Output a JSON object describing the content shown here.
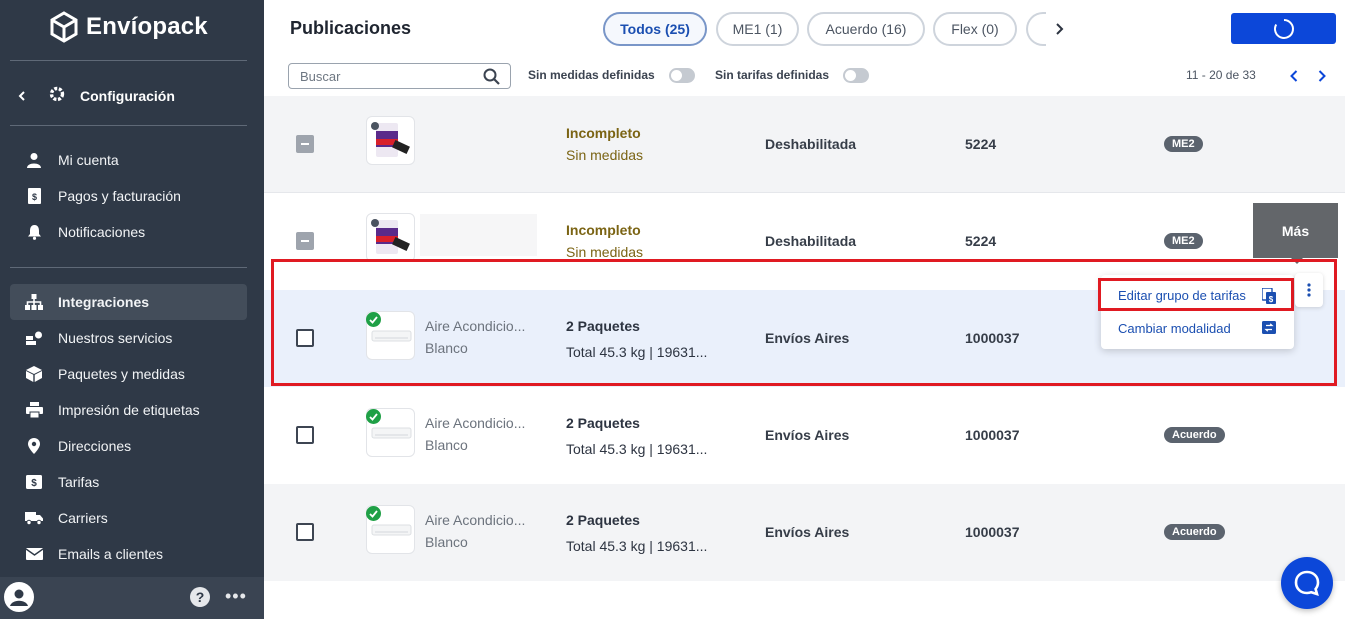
{
  "app": {
    "brand": "Envíopack"
  },
  "sidebar": {
    "config_label": "Configuración",
    "account_items": [
      {
        "label": "Mi cuenta",
        "icon": "user-icon"
      },
      {
        "label": "Pagos y facturación",
        "icon": "invoice-icon"
      },
      {
        "label": "Notificaciones",
        "icon": "bell-icon"
      }
    ],
    "main_items": [
      {
        "label": "Integraciones",
        "icon": "sitemap-icon",
        "active": true
      },
      {
        "label": "Nuestros servicios",
        "icon": "services-icon"
      },
      {
        "label": "Paquetes y medidas",
        "icon": "box-icon"
      },
      {
        "label": "Impresión de etiquetas",
        "icon": "printer-icon"
      },
      {
        "label": "Direcciones",
        "icon": "map-pin-icon"
      },
      {
        "label": "Tarifas",
        "icon": "money-icon"
      },
      {
        "label": "Carriers",
        "icon": "truck-icon"
      },
      {
        "label": "Emails a clientes",
        "icon": "mail-icon"
      }
    ],
    "footer": {
      "help": "?",
      "more": "•••"
    }
  },
  "header": {
    "title": "Publicaciones",
    "tabs": [
      {
        "label": "Todos (25)",
        "active": true
      },
      {
        "label": "ME1 (1)"
      },
      {
        "label": "Acuerdo (16)"
      },
      {
        "label": "Flex (0)"
      }
    ]
  },
  "filters": {
    "search_placeholder": "Buscar",
    "toggle1_label": "Sin medidas definidas",
    "toggle2_label": "Sin tarifas definidas",
    "pagination": "11 - 20 de 33"
  },
  "rows": [
    {
      "status_line1": "Incompleto",
      "status_line2": "Sin medidas",
      "shipping": "Deshabilitada",
      "id": "5224",
      "mode": "ME2"
    },
    {
      "status_line1": "Incompleto",
      "status_line2": "Sin medidas",
      "shipping": "Deshabilitada",
      "id": "5224",
      "mode": "ME2"
    },
    {
      "product_line1": "Aire Acondicio...",
      "product_line2": "Blanco",
      "packages": "2 Paquetes",
      "details": "Total 45.3 kg | 19631...",
      "shipping": "Envíos Aires",
      "id": "1000037",
      "mode": ""
    },
    {
      "product_line1": "Aire Acondicio...",
      "product_line2": "Blanco",
      "packages": "2 Paquetes",
      "details": "Total 45.3 kg | 19631...",
      "shipping": "Envíos Aires",
      "id": "1000037",
      "mode": "Acuerdo"
    },
    {
      "product_line1": "Aire Acondicio...",
      "product_line2": "Blanco",
      "packages": "2 Paquetes",
      "details": "Total 45.3 kg | 19631...",
      "shipping": "Envíos Aires",
      "id": "1000037",
      "mode": "Acuerdo"
    }
  ],
  "tooltip": {
    "label": "Más"
  },
  "menu": {
    "items": [
      {
        "label": "Editar grupo de tarifas",
        "icon": "tariff-group-icon"
      },
      {
        "label": "Cambiar modalidad",
        "icon": "swap-icon"
      }
    ]
  },
  "colors": {
    "sidebar": "#2f3947",
    "primary": "#0c47d9",
    "highlight": "#e01a22",
    "status": "#7b6414"
  }
}
